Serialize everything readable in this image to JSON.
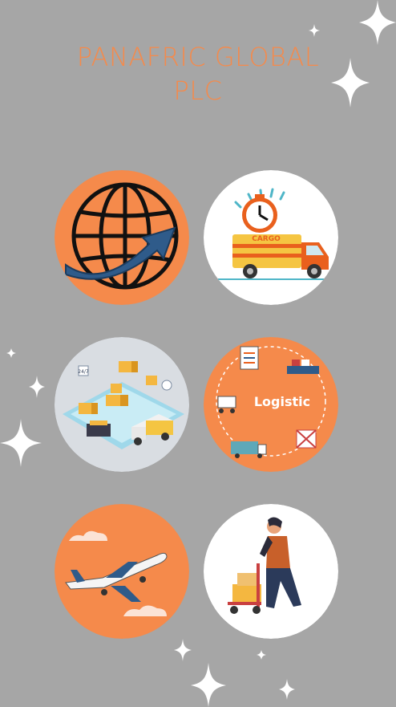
{
  "page": {
    "title_line1": "PANAFRIC GLOBAL",
    "title_line2": "PLC",
    "logistic_label": "Logistic",
    "truck_label": "CARGO",
    "clock_label": "24/7"
  },
  "colors": {
    "background": "#a6a6a6",
    "accent": "#f58a4b",
    "white": "#ffffff"
  },
  "icons": [
    "globe-icon",
    "delivery-truck-icon",
    "warehouse-icon",
    "logistic-cycle-icon",
    "airplane-icon",
    "worker-cart-icon",
    "sparkle-icon"
  ]
}
